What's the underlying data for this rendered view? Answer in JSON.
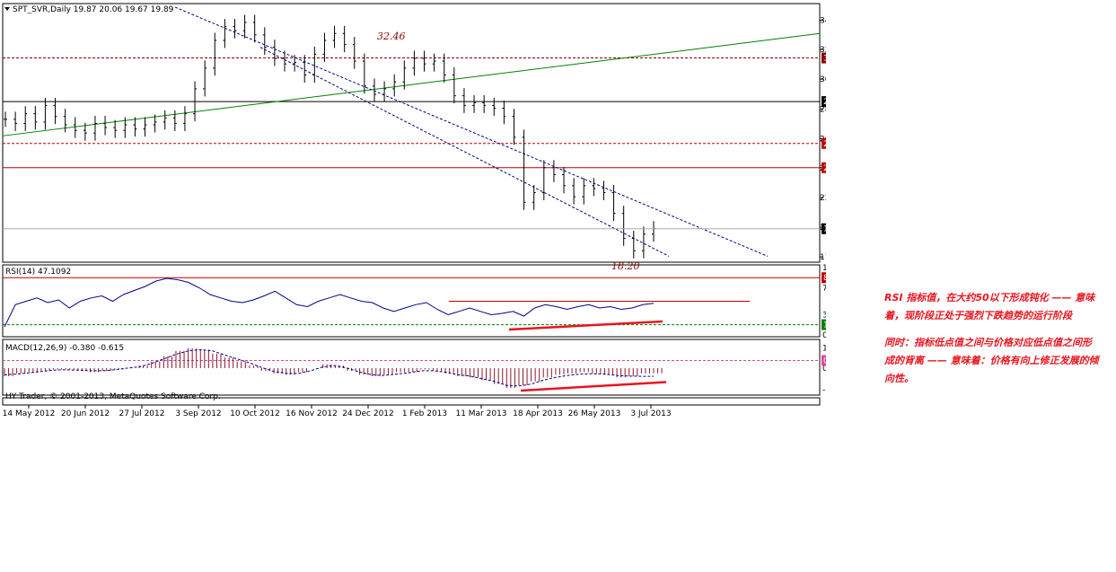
{
  "chart_data": [
    {
      "type": "bar",
      "panel": "price",
      "symbol_header": "SPT_SVR,Daily  19.87 20.06 19.67 19.89",
      "y_ticks": [
        "34.95",
        "32.85",
        "30.70",
        "28.55",
        "26.40",
        "24.30",
        "22.15",
        "20.00",
        "17.85"
      ],
      "ylim": [
        17.6,
        35.9
      ],
      "x_tick_labels": [
        "14 May 2012",
        "20 Jun 2012",
        "27 Jul 2012",
        "3 Sep 2012",
        "10 Oct 2012",
        "16 Nov 2012",
        "24 Dec 2012",
        "1 Feb 2013",
        "11 Mar 2013",
        "18 Apr 2013",
        "26 May 2013",
        "3 Jul 2013"
      ],
      "close_series": [
        27.8,
        27.5,
        28.2,
        27.6,
        28.8,
        28.0,
        27.4,
        27.0,
        26.8,
        27.5,
        27.2,
        27.0,
        27.4,
        27.1,
        27.4,
        27.6,
        27.9,
        27.5,
        28.2,
        30.0,
        31.5,
        33.5,
        34.5,
        34.2,
        34.8,
        33.9,
        33.0,
        32.2,
        31.8,
        31.9,
        31.0,
        32.5,
        33.5,
        34.0,
        33.2,
        32.0,
        30.2,
        29.6,
        30.0,
        30.5,
        31.5,
        32.2,
        31.8,
        32.0,
        31.0,
        29.5,
        28.8,
        29.0,
        28.8,
        28.6,
        28.0,
        26.5,
        21.8,
        22.5,
        24.3,
        23.8,
        23.0,
        22.2,
        23.0,
        22.8,
        22.5,
        21.0,
        19.2,
        18.3,
        19.5,
        19.89
      ],
      "last_price": "19.89",
      "annotations": [
        "32.46",
        "18.20"
      ],
      "horizontal_levels": [
        {
          "label": "32.23",
          "value": 32.23,
          "style": "dashed",
          "color": "#8b0000"
        },
        {
          "label": "29.08",
          "value": 29.08,
          "style": "solid",
          "color": "#000000"
        },
        {
          "label": "26.05",
          "value": 26.05,
          "style": "dashed",
          "color": "#c00000"
        },
        {
          "label": "24.30",
          "value": 24.3,
          "style": "solid",
          "color": "#c00000"
        }
      ],
      "trendlines": [
        {
          "name": "support",
          "color": "#008000",
          "from": {
            "x": 0,
            "y": 26.6
          },
          "to": {
            "x": 1,
            "y": 34.0
          }
        },
        {
          "name": "channel-top",
          "color": "#00008b",
          "style": "dashed"
        },
        {
          "name": "channel-bottom",
          "color": "#00008b",
          "style": "dashed"
        }
      ]
    },
    {
      "type": "line",
      "panel": "rsi",
      "header": "RSI(14) 47.1092",
      "y_ticks": [
        "100",
        "70",
        "30",
        "0"
      ],
      "ylim": [
        0,
        100
      ],
      "level_tags": [
        "85.03",
        "15.24"
      ],
      "values": [
        12,
        45,
        50,
        55,
        48,
        52,
        40,
        50,
        55,
        58,
        50,
        60,
        66,
        72,
        80,
        84,
        82,
        78,
        70,
        60,
        55,
        50,
        48,
        52,
        58,
        65,
        55,
        45,
        42,
        50,
        55,
        60,
        55,
        50,
        48,
        40,
        35,
        40,
        45,
        48,
        38,
        30,
        35,
        40,
        35,
        30,
        32,
        35,
        28,
        40,
        45,
        42,
        38,
        42,
        45,
        40,
        42,
        38,
        40,
        45,
        47
      ]
    },
    {
      "type": "bar",
      "panel": "macd",
      "header": "MACD(12,26,9) -0.380 -0.615",
      "y_ticks": [
        "1.538",
        "0.00",
        "-1.595"
      ],
      "ylim": [
        -1.9,
        1.9
      ],
      "level_tags": [
        "0.58"
      ],
      "histogram": [
        -0.6,
        -0.4,
        -0.3,
        -0.2,
        -0.1,
        -0.1,
        -0.2,
        -0.3,
        -0.2,
        -0.1,
        0.0,
        0.2,
        0.5,
        0.9,
        1.3,
        1.5,
        1.4,
        1.1,
        0.8,
        0.5,
        0.2,
        -0.2,
        -0.4,
        -0.5,
        -0.3,
        0.0,
        0.3,
        0.2,
        -0.2,
        -0.5,
        -0.6,
        -0.5,
        -0.3,
        -0.3,
        -0.1,
        -0.2,
        -0.4,
        -0.6,
        -0.7,
        -0.9,
        -1.2,
        -1.5,
        -1.3,
        -1.0,
        -0.7,
        -0.5,
        -0.4,
        -0.3,
        -0.4,
        -0.5,
        -0.7,
        -0.6,
        -0.4,
        -0.38
      ],
      "signal": [
        -0.5,
        -0.45,
        -0.35,
        -0.25,
        -0.15,
        -0.12,
        -0.15,
        -0.2,
        -0.2,
        -0.12,
        0.0,
        0.1,
        0.35,
        0.7,
        1.05,
        1.3,
        1.4,
        1.3,
        1.0,
        0.7,
        0.4,
        0.05,
        -0.25,
        -0.4,
        -0.4,
        -0.2,
        0.1,
        0.2,
        0.0,
        -0.3,
        -0.5,
        -0.55,
        -0.45,
        -0.35,
        -0.2,
        -0.2,
        -0.3,
        -0.5,
        -0.6,
        -0.8,
        -1.0,
        -1.3,
        -1.35,
        -1.2,
        -0.9,
        -0.7,
        -0.55,
        -0.45,
        -0.42,
        -0.45,
        -0.55,
        -0.6,
        -0.62,
        -0.615
      ]
    }
  ],
  "footer_text": "HY Trader, © 2001-2013, MetaQuotes Software Corp.",
  "notes": {
    "note1": "RSI 指标值，在大约50以下形成钝化 —— 意味着，现阶段正处于强烈下跌趋势的运行阶段",
    "note2": "同时：指标低点值之间与价格对应低点值之间形成的背离 —— 意味着：价格有向上修正发展的倾向性。"
  },
  "colors": {
    "price_bars": "#000000",
    "green_trend": "#008000",
    "dashed_blue": "#00008b",
    "dark_red": "#8b0000",
    "red": "#c00000",
    "last_price_tag": "#000000",
    "macd_hist": "#8b1a2b",
    "macd_tag": "#e0459b",
    "rsi_line": "#00008b",
    "divergence": "#e8141e",
    "note_text": "#e8141e"
  }
}
